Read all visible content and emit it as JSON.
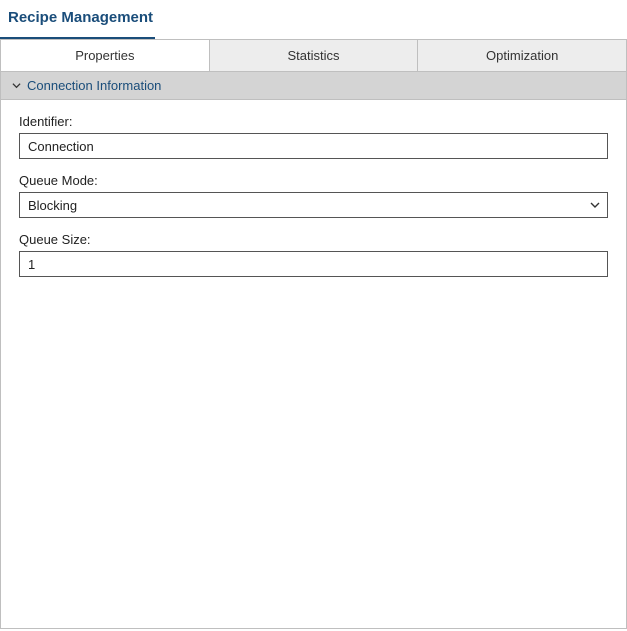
{
  "header": {
    "title": "Recipe Management"
  },
  "tabs": [
    {
      "label": "Properties",
      "active": true
    },
    {
      "label": "Statistics",
      "active": false
    },
    {
      "label": "Optimization",
      "active": false
    }
  ],
  "section": {
    "title": "Connection Information"
  },
  "form": {
    "identifier": {
      "label": "Identifier:",
      "value": "Connection"
    },
    "queue_mode": {
      "label": "Queue Mode:",
      "value": "Blocking"
    },
    "queue_size": {
      "label": "Queue Size:",
      "value": "1"
    }
  }
}
